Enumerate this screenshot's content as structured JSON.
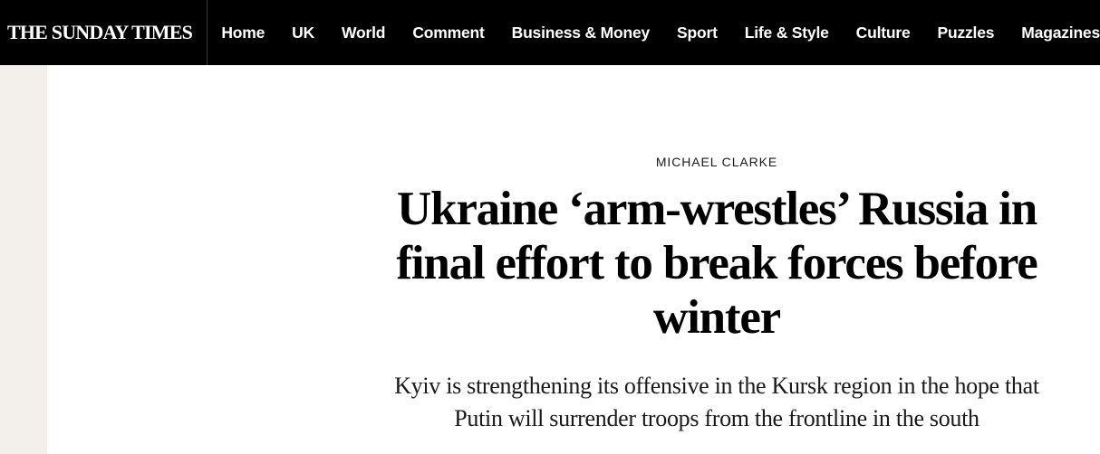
{
  "header": {
    "masthead": "THE SUNDAY TIMES",
    "nav": [
      "Home",
      "UK",
      "World",
      "Comment",
      "Business & Money",
      "Sport",
      "Life & Style",
      "Culture",
      "Puzzles",
      "Magazines"
    ]
  },
  "article": {
    "byline": "MICHAEL CLARKE",
    "headline": "Ukraine ‘arm-wrestles’ Russia in final effort to break forces before winter",
    "standfirst": "Kyiv is strengthening its offensive in the Kursk region in the hope that Putin will surrender troops from the frontline in the south"
  },
  "colors": {
    "topbar": "#000000",
    "rail": "#f3efea",
    "text": "#000000"
  }
}
